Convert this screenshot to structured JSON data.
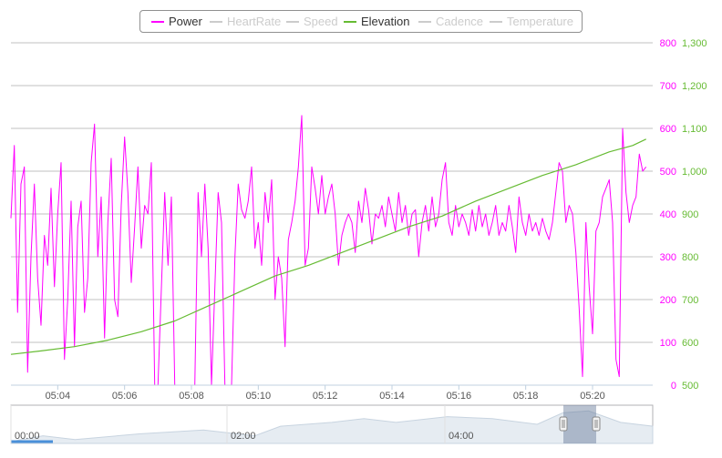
{
  "legend": {
    "items": [
      {
        "label": "Power",
        "color": "#ff00ff",
        "active": true
      },
      {
        "label": "HeartRate",
        "color": "#cccccc",
        "active": false
      },
      {
        "label": "Speed",
        "color": "#cccccc",
        "active": false
      },
      {
        "label": "Elevation",
        "color": "#66bb33",
        "active": true
      },
      {
        "label": "Cadence",
        "color": "#cccccc",
        "active": false
      },
      {
        "label": "Temperature",
        "color": "#cccccc",
        "active": false
      }
    ]
  },
  "navigator": {
    "tick_labels": [
      "00:00",
      "02:00",
      "04:00"
    ]
  },
  "chart_data": {
    "type": "line",
    "x_tick_labels": [
      "05:04",
      "05:06",
      "05:08",
      "05:10",
      "05:12",
      "05:14",
      "05:16",
      "05:18",
      "05:20"
    ],
    "x_range_minutes": [
      302.6,
      321.8
    ],
    "y_axes": [
      {
        "series": "Power",
        "color": "#ff00ff",
        "ylim": [
          0,
          800
        ],
        "ticks": [
          0,
          100,
          200,
          300,
          400,
          500,
          600,
          700,
          800
        ]
      },
      {
        "series": "Elevation",
        "color": "#66bb33",
        "ylim": [
          500,
          1300
        ],
        "ticks": [
          "500",
          "600",
          "700",
          "800",
          "900",
          "1,000",
          "1,100",
          "1,200",
          "1,300"
        ]
      }
    ],
    "grid": true,
    "legend_position": "top-center",
    "series": [
      {
        "name": "Power",
        "color": "#ff00ff",
        "points": [
          [
            302.6,
            390
          ],
          [
            302.7,
            560
          ],
          [
            302.8,
            170
          ],
          [
            302.9,
            470
          ],
          [
            303.0,
            510
          ],
          [
            303.1,
            30
          ],
          [
            303.2,
            300
          ],
          [
            303.3,
            470
          ],
          [
            303.4,
            250
          ],
          [
            303.5,
            140
          ],
          [
            303.6,
            350
          ],
          [
            303.7,
            280
          ],
          [
            303.8,
            460
          ],
          [
            303.9,
            230
          ],
          [
            304.0,
            400
          ],
          [
            304.1,
            520
          ],
          [
            304.2,
            60
          ],
          [
            304.3,
            200
          ],
          [
            304.4,
            430
          ],
          [
            304.5,
            90
          ],
          [
            304.6,
            370
          ],
          [
            304.7,
            430
          ],
          [
            304.8,
            170
          ],
          [
            304.9,
            250
          ],
          [
            305.0,
            520
          ],
          [
            305.1,
            610
          ],
          [
            305.2,
            300
          ],
          [
            305.3,
            440
          ],
          [
            305.4,
            110
          ],
          [
            305.5,
            380
          ],
          [
            305.6,
            530
          ],
          [
            305.7,
            200
          ],
          [
            305.8,
            160
          ],
          [
            305.9,
            420
          ],
          [
            306.0,
            580
          ],
          [
            306.1,
            450
          ],
          [
            306.2,
            240
          ],
          [
            306.3,
            370
          ],
          [
            306.4,
            510
          ],
          [
            306.5,
            320
          ],
          [
            306.6,
            420
          ],
          [
            306.7,
            400
          ],
          [
            306.8,
            520
          ],
          [
            306.9,
            0
          ],
          [
            307.0,
            0
          ],
          [
            307.2,
            450
          ],
          [
            307.3,
            280
          ],
          [
            307.4,
            440
          ],
          [
            307.5,
            0
          ],
          [
            308.0,
            0
          ],
          [
            308.1,
            0
          ],
          [
            308.2,
            450
          ],
          [
            308.3,
            300
          ],
          [
            308.4,
            470
          ],
          [
            308.5,
            320
          ],
          [
            308.6,
            0
          ],
          [
            308.8,
            450
          ],
          [
            308.9,
            380
          ],
          [
            309.0,
            0
          ],
          [
            309.2,
            0
          ],
          [
            309.3,
            300
          ],
          [
            309.4,
            470
          ],
          [
            309.5,
            410
          ],
          [
            309.6,
            390
          ],
          [
            309.7,
            430
          ],
          [
            309.8,
            510
          ],
          [
            309.9,
            320
          ],
          [
            310.0,
            380
          ],
          [
            310.1,
            280
          ],
          [
            310.2,
            450
          ],
          [
            310.3,
            380
          ],
          [
            310.4,
            480
          ],
          [
            310.5,
            200
          ],
          [
            310.6,
            300
          ],
          [
            310.7,
            250
          ],
          [
            310.8,
            90
          ],
          [
            310.9,
            340
          ],
          [
            311.0,
            380
          ],
          [
            311.1,
            430
          ],
          [
            311.2,
            510
          ],
          [
            311.3,
            630
          ],
          [
            311.4,
            280
          ],
          [
            311.5,
            320
          ],
          [
            311.6,
            510
          ],
          [
            311.7,
            460
          ],
          [
            311.8,
            400
          ],
          [
            311.9,
            490
          ],
          [
            312.0,
            400
          ],
          [
            312.1,
            440
          ],
          [
            312.2,
            470
          ],
          [
            312.3,
            400
          ],
          [
            312.4,
            280
          ],
          [
            312.5,
            350
          ],
          [
            312.6,
            380
          ],
          [
            312.7,
            400
          ],
          [
            312.8,
            380
          ],
          [
            312.9,
            310
          ],
          [
            313.0,
            430
          ],
          [
            313.1,
            380
          ],
          [
            313.2,
            460
          ],
          [
            313.3,
            410
          ],
          [
            313.4,
            330
          ],
          [
            313.5,
            400
          ],
          [
            313.6,
            390
          ],
          [
            313.7,
            420
          ],
          [
            313.8,
            370
          ],
          [
            313.9,
            440
          ],
          [
            314.0,
            400
          ],
          [
            314.1,
            360
          ],
          [
            314.2,
            450
          ],
          [
            314.3,
            380
          ],
          [
            314.4,
            420
          ],
          [
            314.5,
            350
          ],
          [
            314.6,
            400
          ],
          [
            314.7,
            410
          ],
          [
            314.8,
            300
          ],
          [
            314.9,
            380
          ],
          [
            315.0,
            420
          ],
          [
            315.1,
            360
          ],
          [
            315.2,
            440
          ],
          [
            315.3,
            370
          ],
          [
            315.4,
            400
          ],
          [
            315.5,
            480
          ],
          [
            315.6,
            520
          ],
          [
            315.7,
            380
          ],
          [
            315.8,
            350
          ],
          [
            315.9,
            420
          ],
          [
            316.0,
            370
          ],
          [
            316.1,
            400
          ],
          [
            316.2,
            380
          ],
          [
            316.3,
            350
          ],
          [
            316.4,
            410
          ],
          [
            316.5,
            360
          ],
          [
            316.6,
            420
          ],
          [
            316.7,
            370
          ],
          [
            316.8,
            400
          ],
          [
            316.9,
            350
          ],
          [
            317.0,
            380
          ],
          [
            317.1,
            420
          ],
          [
            317.2,
            350
          ],
          [
            317.3,
            380
          ],
          [
            317.4,
            360
          ],
          [
            317.5,
            420
          ],
          [
            317.6,
            370
          ],
          [
            317.7,
            310
          ],
          [
            317.8,
            440
          ],
          [
            317.9,
            380
          ],
          [
            318.0,
            350
          ],
          [
            318.1,
            400
          ],
          [
            318.2,
            360
          ],
          [
            318.3,
            380
          ],
          [
            318.4,
            350
          ],
          [
            318.5,
            390
          ],
          [
            318.6,
            360
          ],
          [
            318.7,
            340
          ],
          [
            318.8,
            380
          ],
          [
            318.9,
            450
          ],
          [
            319.0,
            520
          ],
          [
            319.1,
            500
          ],
          [
            319.2,
            380
          ],
          [
            319.3,
            420
          ],
          [
            319.4,
            400
          ],
          [
            319.5,
            310
          ],
          [
            319.6,
            180
          ],
          [
            319.7,
            20
          ],
          [
            319.8,
            380
          ],
          [
            319.9,
            230
          ],
          [
            320.0,
            120
          ],
          [
            320.1,
            360
          ],
          [
            320.2,
            380
          ],
          [
            320.3,
            440
          ],
          [
            320.4,
            460
          ],
          [
            320.5,
            480
          ],
          [
            320.6,
            380
          ],
          [
            320.7,
            60
          ],
          [
            320.8,
            20
          ],
          [
            320.9,
            600
          ],
          [
            321.0,
            450
          ],
          [
            321.1,
            380
          ],
          [
            321.2,
            420
          ],
          [
            321.3,
            440
          ],
          [
            321.4,
            540
          ],
          [
            321.5,
            500
          ],
          [
            321.6,
            510
          ]
        ]
      },
      {
        "name": "Elevation",
        "color": "#66bb33",
        "points": [
          [
            302.6,
            572
          ],
          [
            303.5,
            580
          ],
          [
            304.5,
            590
          ],
          [
            305.5,
            605
          ],
          [
            306.5,
            625
          ],
          [
            307.5,
            650
          ],
          [
            308.5,
            685
          ],
          [
            309.5,
            720
          ],
          [
            310.5,
            755
          ],
          [
            311.5,
            780
          ],
          [
            312.5,
            810
          ],
          [
            313.5,
            840
          ],
          [
            314.5,
            870
          ],
          [
            315.5,
            895
          ],
          [
            316.5,
            930
          ],
          [
            317.5,
            960
          ],
          [
            318.5,
            990
          ],
          [
            319.5,
            1015
          ],
          [
            320.5,
            1045
          ],
          [
            321.2,
            1060
          ],
          [
            321.6,
            1075
          ]
        ]
      }
    ]
  }
}
